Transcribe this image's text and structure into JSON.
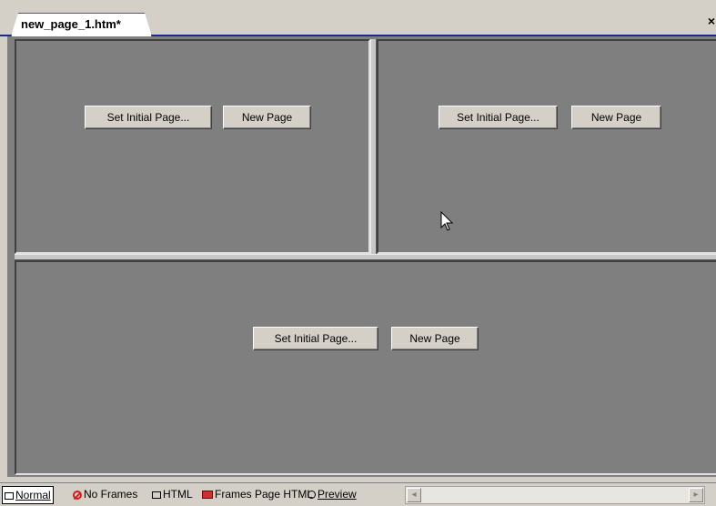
{
  "tab": {
    "title": "new_page_1.htm*"
  },
  "window": {
    "close_label": "×"
  },
  "frames": {
    "top_left": {
      "set_initial_page": "Set Initial Page...",
      "new_page": "New Page"
    },
    "top_right": {
      "set_initial_page": "Set Initial Page...",
      "new_page": "New Page"
    },
    "bottom": {
      "set_initial_page": "Set Initial Page...",
      "new_page": "New Page"
    }
  },
  "view_tabs": {
    "normal": "Normal",
    "no_frames": "No Frames",
    "html": "HTML",
    "frames_page_html": "Frames Page HTML",
    "preview": "Preview"
  },
  "scroll": {
    "left_arrow": "◂",
    "right_arrow": "▸"
  },
  "colors": {
    "frame_bg": "#7f7f7f",
    "tab_underline": "#1b2a8a",
    "chrome": "#d4d0c8"
  }
}
